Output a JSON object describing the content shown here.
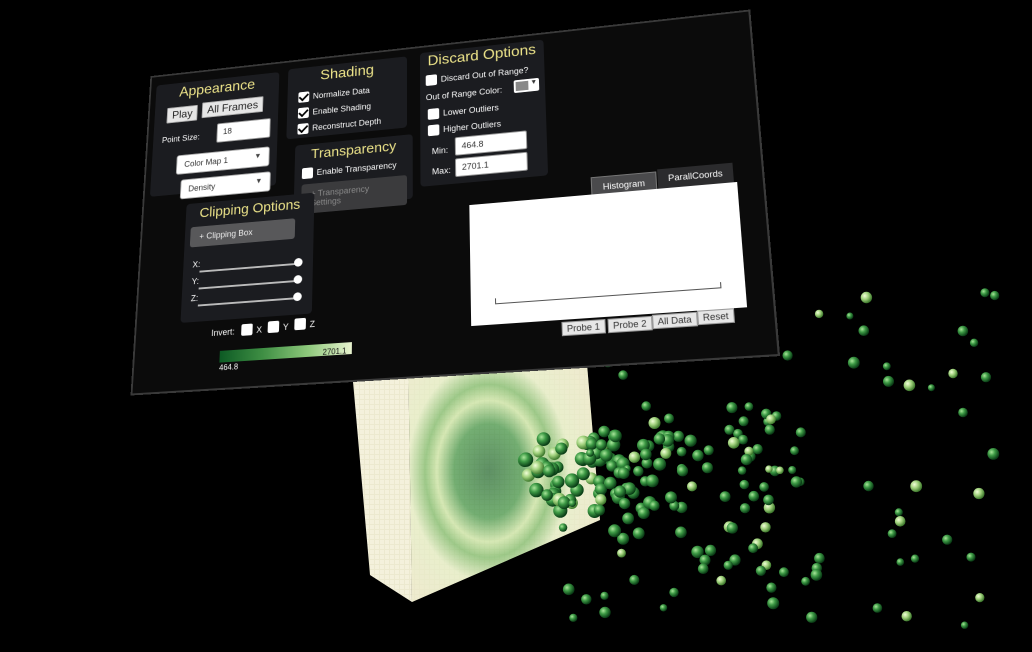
{
  "appearance": {
    "title": "Appearance",
    "play_label": "Play",
    "all_frames_label": "All Frames",
    "point_size_label": "Point Size:",
    "point_size_value": "18",
    "colormap_selected": "Color Map 1",
    "attribute_selected": "Density"
  },
  "shading": {
    "title": "Shading",
    "normalize_label": "Normalize Data",
    "normalize_checked": true,
    "enable_shading_label": "Enable Shading",
    "enable_shading_checked": true,
    "reconstruct_depth_label": "Reconstruct Depth",
    "reconstruct_depth_checked": true
  },
  "transparency": {
    "title": "Transparency",
    "enable_label": "Enable Transparency",
    "settings_label": "Transparency Settings"
  },
  "discard": {
    "title": "Discard Options",
    "discard_out_of_range_label": "Discard Out of Range?",
    "out_of_range_color_label": "Out of Range Color:",
    "out_of_range_color": "#888888",
    "lower_outliers_label": "Lower Outliers",
    "higher_outliers_label": "Higher Outliers",
    "min_label": "Min:",
    "min_value": "464.8",
    "max_label": "Max:",
    "max_value": "2701.1"
  },
  "clipping": {
    "title": "Clipping Options",
    "clipping_box_label": "Clipping Box",
    "x_label": "X:",
    "y_label": "Y:",
    "z_label": "Z:",
    "invert_label": "Invert:",
    "invert_x": "X",
    "invert_y": "Y",
    "invert_z": "Z"
  },
  "plot": {
    "tabs": [
      "Histogram",
      "ParallCoords"
    ],
    "active_tab": "Histogram",
    "buttons": [
      "Probe 1",
      "Probe 2",
      "All Data",
      "Reset"
    ]
  },
  "legend": {
    "min": "464.8",
    "max": "2701.1",
    "colors": [
      "#0d5a24",
      "#3f8f44",
      "#8cc77a",
      "#e8f3cf"
    ]
  },
  "accent_color": "#eee58a"
}
